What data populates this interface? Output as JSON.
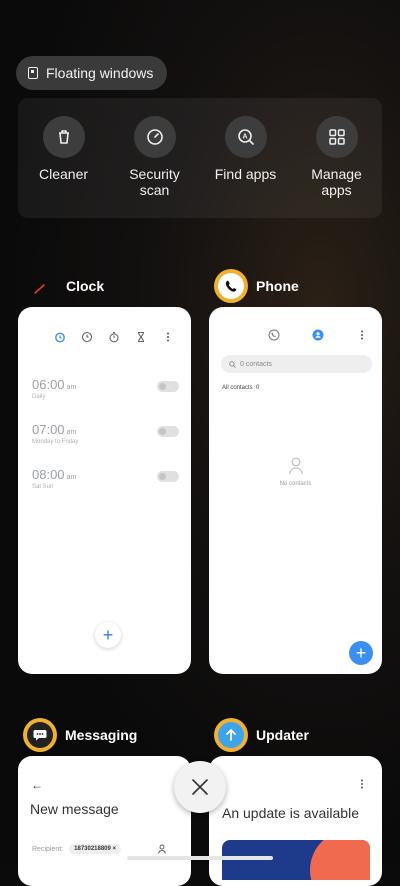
{
  "floating_windows": {
    "label": "Floating windows",
    "icon": "floating-window-icon"
  },
  "tools": [
    {
      "label": "Cleaner",
      "icon": "trash-icon"
    },
    {
      "label": "Security\nscan",
      "icon": "security-scan-icon"
    },
    {
      "label": "Find apps",
      "icon": "find-apps-icon"
    },
    {
      "label": "Manage\napps",
      "icon": "grid-icon"
    }
  ],
  "cards": {
    "clock": {
      "title": "Clock",
      "alarms": [
        {
          "time": "06:00",
          "ampm": "am",
          "repeat": "Daily"
        },
        {
          "time": "07:00",
          "ampm": "am",
          "repeat": "Monday to Friday"
        },
        {
          "time": "08:00",
          "ampm": "am",
          "repeat": "Sat Sun"
        }
      ]
    },
    "phone": {
      "title": "Phone",
      "search_placeholder": "0 contacts",
      "all_contacts_label": "All contacts",
      "all_contacts_count": "0",
      "empty_label": "No contacts"
    },
    "messaging": {
      "title": "Messaging",
      "new_message": "New message",
      "recipient_label": "Recipient:",
      "recipient_value": "18730218809"
    },
    "updater": {
      "title": "Updater",
      "update_text": "An update is available"
    }
  },
  "colors": {
    "accent_blue": "#3b8ff0",
    "clock_red": "#e53935",
    "phone_gold": "#f0b133"
  }
}
